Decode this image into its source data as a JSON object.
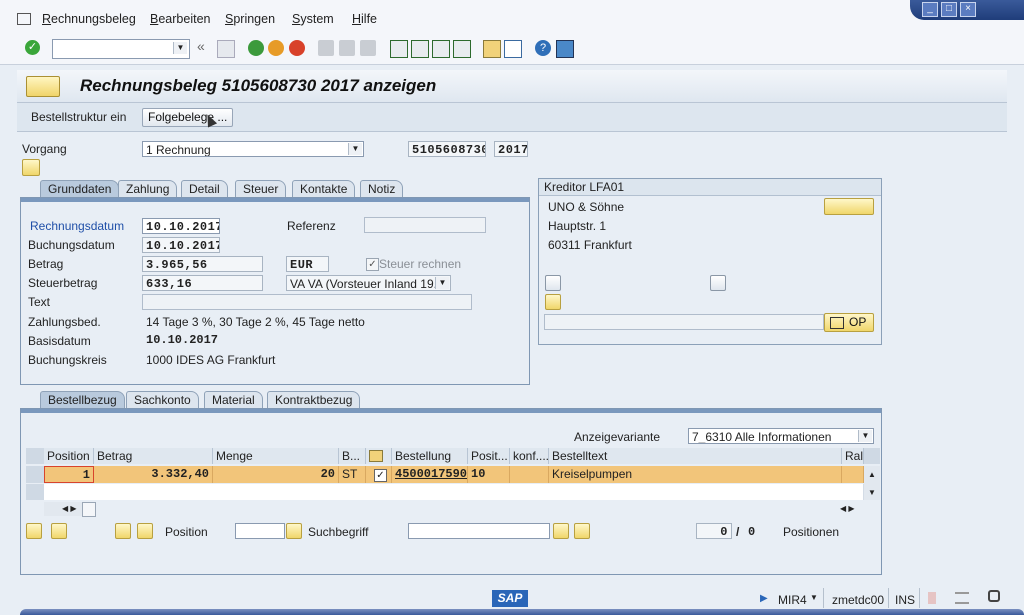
{
  "menu": {
    "items": [
      "Rechnungsbeleg",
      "Bearbeiten",
      "Springen",
      "System",
      "Hilfe"
    ]
  },
  "toolbar": {
    "command_value": "",
    "icons": [
      "enter-icon",
      "back-icon",
      "exit-icon",
      "cancel-icon",
      "print-icon",
      "find-icon",
      "find-next-icon",
      "first-page-icon",
      "previous-page-icon",
      "next-page-icon",
      "last-page-icon",
      "new-session-icon",
      "shortcut-icon",
      "help-icon",
      "customize-icon"
    ]
  },
  "title": "Rechnungsbeleg 5105608730 2017 anzeigen",
  "appbar": {
    "struct_button": "Bestellstruktur ein",
    "followon_button": "Folgebelege ..."
  },
  "header": {
    "vorgang_label": "Vorgang",
    "vorgang_value": "1 Rechnung",
    "doc_number": "5105608730",
    "fiscal_year": "2017"
  },
  "basic_tabs": [
    "Grunddaten",
    "Zahlung",
    "Detail",
    "Steuer",
    "Kontakte",
    "Notiz"
  ],
  "basic": {
    "rechnungsdatum_label": "Rechnungsdatum",
    "rechnungsdatum": "10.10.2017",
    "referenz_label": "Referenz",
    "referenz": "",
    "buchungsdatum_label": "Buchungsdatum",
    "buchungsdatum": "10.10.2017",
    "betrag_label": "Betrag",
    "betrag": "3.965,56",
    "currency": "EUR",
    "steuer_rechnen_label": "Steuer rechnen",
    "steuerbetrag_label": "Steuerbetrag",
    "steuerbetrag": "633,16",
    "tax_code": "VA VA (Vorsteuer Inland 19...",
    "text_label": "Text",
    "text": "",
    "zahlungsbed_label": "Zahlungsbed.",
    "zahlungsbed": "14 Tage 3 %, 30 Tage 2 %, 45 Tage netto",
    "basisdatum_label": "Basisdatum",
    "basisdatum": "10.10.2017",
    "buchungskreis_label": "Buchungskreis",
    "buchungskreis": "1000 IDES AG Frankfurt"
  },
  "vendor": {
    "title": "Kreditor LFA01",
    "name": "UNO & Söhne",
    "street": "Hauptstr. 1",
    "city": "60311 Frankfurt",
    "op_button": "OP"
  },
  "item_tabs": [
    "Bestellbezug",
    "Sachkonto",
    "Material",
    "Kontraktbezug"
  ],
  "items": {
    "layout_label": "Anzeigevariante",
    "layout_value": "7_6310 Alle Informationen",
    "columns": [
      "Position",
      "Betrag",
      "Menge",
      "B...",
      "Bestellung",
      "Posit...",
      "konf....",
      "Bestelltext",
      "Ral"
    ],
    "rows": [
      {
        "position": "1",
        "betrag": "3.332,40",
        "menge": "20",
        "unit": "ST",
        "bestellung": "4500017590",
        "posit": "10",
        "konf": "",
        "bestelltext": "Kreiselpumpen"
      }
    ],
    "position_label": "Position",
    "position_value": "",
    "search_label": "Suchbegriff",
    "search_value": "",
    "count_current": "0",
    "count_sep": "/",
    "count_total": "0",
    "count_label": "Positionen"
  },
  "status": {
    "logo": "SAP",
    "transaction": "MIR4",
    "server": "zmetdc00",
    "mode": "INS"
  }
}
